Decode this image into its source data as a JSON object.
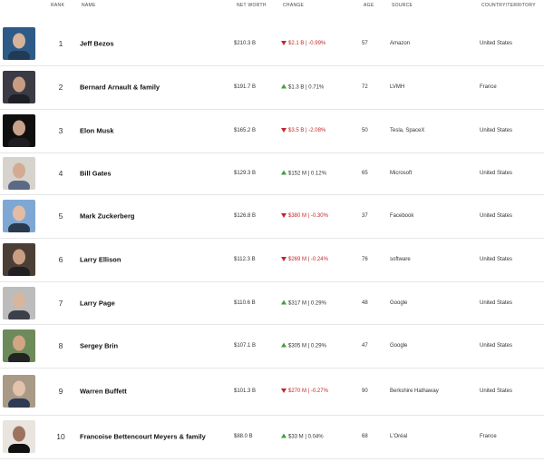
{
  "header": {
    "rank": "RANK",
    "name": "NAME",
    "net_worth": "NET WORTH",
    "change": "CHANGE",
    "age": "AGE",
    "source": "SOURCE",
    "country": "COUNTRY/TERRITORY"
  },
  "colors": {
    "down": "#c0292a",
    "up": "#3fa23f"
  },
  "rows": [
    {
      "rank": "1",
      "name": "Jeff Bezos",
      "net_worth": "$210.3 B",
      "change": "$2.1 B | -0.99%",
      "direction": "down",
      "age": "57",
      "source": "Amazon",
      "country": "United States"
    },
    {
      "rank": "2",
      "name": "Bernard Arnault & family",
      "net_worth": "$191.7 B",
      "change": "$1.3 B | 0.71%",
      "direction": "up",
      "age": "72",
      "source": "LVMH",
      "country": "France"
    },
    {
      "rank": "3",
      "name": "Elon Musk",
      "net_worth": "$165.2 B",
      "change": "$3.5 B | -2.08%",
      "direction": "down",
      "age": "50",
      "source": "Tesla, SpaceX",
      "country": "United States"
    },
    {
      "rank": "4",
      "name": "Bill Gates",
      "net_worth": "$129.3 B",
      "change": "$152 M | 0.12%",
      "direction": "up",
      "age": "65",
      "source": "Microsoft",
      "country": "United States"
    },
    {
      "rank": "5",
      "name": "Mark Zuckerberg",
      "net_worth": "$126.8 B",
      "change": "$380 M | -0.30%",
      "direction": "down",
      "age": "37",
      "source": "Facebook",
      "country": "United States"
    },
    {
      "rank": "6",
      "name": "Larry Ellison",
      "net_worth": "$112.3 B",
      "change": "$269 M | -0.24%",
      "direction": "down",
      "age": "76",
      "source": "software",
      "country": "United States"
    },
    {
      "rank": "7",
      "name": "Larry Page",
      "net_worth": "$110.6 B",
      "change": "$317 M | 0.29%",
      "direction": "up",
      "age": "48",
      "source": "Google",
      "country": "United States"
    },
    {
      "rank": "8",
      "name": "Sergey Brin",
      "net_worth": "$107.1 B",
      "change": "$305 M | 0.29%",
      "direction": "up",
      "age": "47",
      "source": "Google",
      "country": "United States"
    },
    {
      "rank": "9",
      "name": "Warren Buffett",
      "net_worth": "$101.3 B",
      "change": "$270 M | -0.27%",
      "direction": "down",
      "age": "90",
      "source": "Berkshire Hathaway",
      "country": "United States"
    },
    {
      "rank": "10",
      "name": "Francoise Bettencourt Meyers & family",
      "net_worth": "$88.0 B",
      "change": "$33 M | 0.04%",
      "direction": "up",
      "age": "68",
      "source": "L'Oréal",
      "country": "France"
    }
  ]
}
